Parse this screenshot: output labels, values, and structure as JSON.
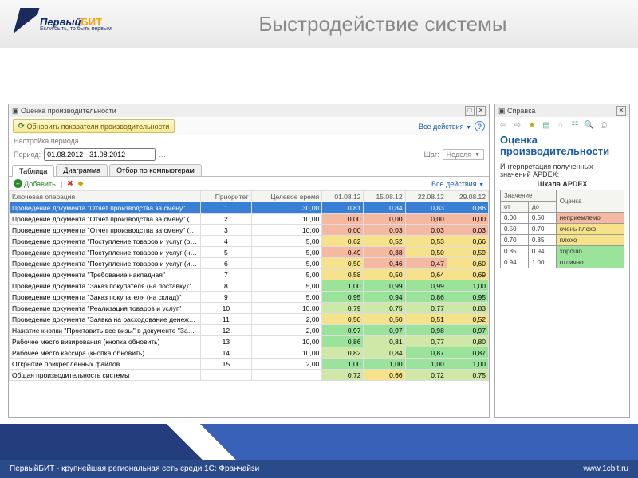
{
  "brand": {
    "name_a": "Первый",
    "name_b": "БИТ",
    "slogan": "Если быть, то быть первым"
  },
  "slide_title": "Быстродействие системы",
  "main_window": {
    "title": "Оценка производительности",
    "btn_refresh": "Обновить показатели производительности",
    "all_actions": "Все действия",
    "period_sect": "Настройка периода",
    "period_label": "Период:",
    "period_value": "01.08.2012 - 31.08.2012",
    "step_label": "Шаг:",
    "step_value": "Неделя",
    "tabs": [
      "Таблица",
      "Диаграмма",
      "Отбор по компьютерам"
    ],
    "btn_add": "Добавить",
    "all_actions2": "Все действия",
    "columns": [
      "Ключевая операция",
      "Приоритет",
      "Целевое время",
      "01.08.12",
      "15.08.12",
      "22.08.12",
      "29.08.12"
    ],
    "rows": [
      {
        "op": "Проведение документа \"Отчет производства за смену\"",
        "pri": 1,
        "t": 30.0,
        "c": [
          0.81,
          0.84,
          0.83,
          0.86
        ]
      },
      {
        "op": "Проведение документа \"Отчет производства за смену\" (ручной ввод)",
        "pri": 2,
        "t": 10.0,
        "c": [
          0.0,
          0.0,
          0.0,
          0.0
        ]
      },
      {
        "op": "Проведение документа \"Отчет производства за смену\" (выпуск брака)",
        "pri": 3,
        "t": 10.0,
        "c": [
          0.0,
          0.03,
          0.03,
          0.03
        ]
      },
      {
        "op": "Проведение документа \"Поступление товаров и услуг (обычный)\"",
        "pri": 4,
        "t": 5.0,
        "c": [
          0.62,
          0.52,
          0.53,
          0.66
        ]
      },
      {
        "op": "Проведение документа \"Поступление товаров и услуг (на транзит)\"",
        "pri": 5,
        "t": 5.0,
        "c": [
          0.49,
          0.38,
          0.5,
          0.59
        ]
      },
      {
        "op": "Проведение документа \"Поступление товаров и услуг (из транзита)\"",
        "pri": 6,
        "t": 5.0,
        "c": [
          0.5,
          0.46,
          0.47,
          0.6
        ]
      },
      {
        "op": "Проведение документа \"Требование накладная\"",
        "pri": 7,
        "t": 5.0,
        "c": [
          0.58,
          0.5,
          0.64,
          0.69
        ]
      },
      {
        "op": "Проведение документа \"Заказ покупателя (на поставку)\"",
        "pri": 8,
        "t": 5.0,
        "c": [
          1.0,
          0.99,
          0.99,
          1.0
        ]
      },
      {
        "op": "Проведение документа \"Заказ покупателя (на склад)\"",
        "pri": 9,
        "t": 5.0,
        "c": [
          0.95,
          0.94,
          0.86,
          0.95
        ]
      },
      {
        "op": "Проведение документа \"Реализация товаров и услуг\"",
        "pri": 10,
        "t": 10.0,
        "c": [
          0.79,
          0.75,
          0.77,
          0.83
        ]
      },
      {
        "op": "Проведение документа \"Заявка на расходование денежных средств (БИТ)\"",
        "pri": 11,
        "t": 2.0,
        "c": [
          0.5,
          0.5,
          0.51,
          0.52
        ]
      },
      {
        "op": "Нажатие кнопки \"Проставить все визы\" в документе \"Заявка на расходован…",
        "pri": 12,
        "t": 2.0,
        "c": [
          0.97,
          0.97,
          0.98,
          0.97
        ]
      },
      {
        "op": "Рабочее место визирования (кнопка обновить)",
        "pri": 13,
        "t": 10.0,
        "c": [
          0.86,
          0.81,
          0.77,
          0.8
        ]
      },
      {
        "op": "Рабочее место кассира (кнопка обновить)",
        "pri": 14,
        "t": 10.0,
        "c": [
          0.82,
          0.84,
          0.87,
          0.87
        ]
      },
      {
        "op": "Открытие прикрепленных файлов",
        "pri": 15,
        "t": 2.0,
        "c": [
          1.0,
          1.0,
          1.0,
          1.0
        ]
      },
      {
        "op": "Общая производительность системы",
        "pri": "",
        "t": "",
        "c": [
          0.72,
          0.66,
          0.72,
          0.75
        ]
      }
    ]
  },
  "help_window": {
    "title": "Справка",
    "h1": "Оценка производительности",
    "desc": "Интерпретация полученных значений APDEX:",
    "scale_title": "Шкала APDEX",
    "scale_head": [
      "Значение",
      "Оценка"
    ],
    "scale_sub": [
      "от",
      "до"
    ],
    "scale_rows": [
      {
        "from": "0.00",
        "to": "0.50",
        "label": "неприемлемо",
        "cls": "apdex-000"
      },
      {
        "from": "0.50",
        "to": "0.70",
        "label": "очень плохо",
        "cls": "apdex-050"
      },
      {
        "from": "0.70",
        "to": "0.85",
        "label": "плохо",
        "cls": "apdex-050"
      },
      {
        "from": "0.85",
        "to": "0.94",
        "label": "хорошо",
        "cls": "apdex-085"
      },
      {
        "from": "0.94",
        "to": "1.00",
        "label": "отлично",
        "cls": "apdex-100"
      }
    ]
  },
  "footer": {
    "text": "ПервыйБИТ - крупнейшая региональная сеть среди 1С: Франчайзи",
    "url": "www.1cbit.ru"
  }
}
